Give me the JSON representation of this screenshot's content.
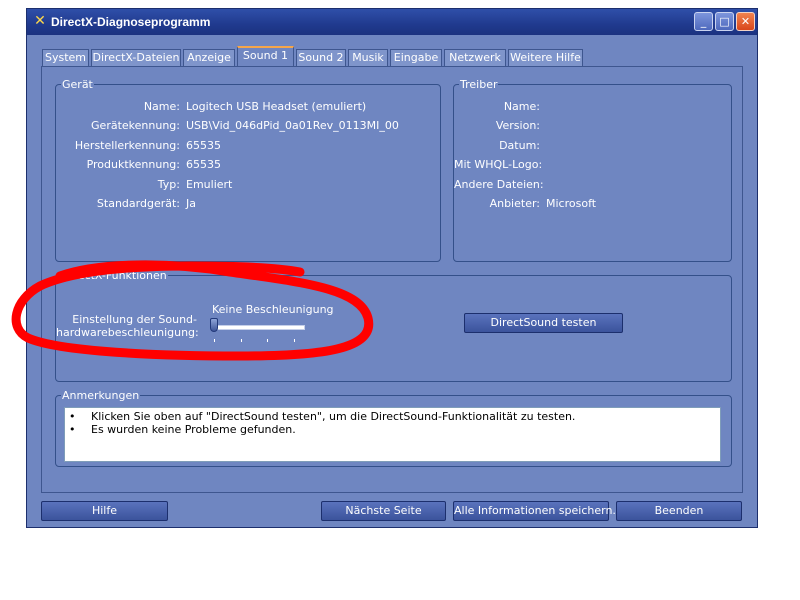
{
  "window": {
    "title": "DirectX-Diagnoseprogramm",
    "icon": "directx-x-icon"
  },
  "title_buttons": {
    "minimize": "_",
    "maximize": "□",
    "close": "✕"
  },
  "tabs": [
    {
      "label": "System"
    },
    {
      "label": "DirectX-Dateien"
    },
    {
      "label": "Anzeige"
    },
    {
      "label": "Sound 1",
      "active": true
    },
    {
      "label": "Sound 2"
    },
    {
      "label": "Musik"
    },
    {
      "label": "Eingabe"
    },
    {
      "label": "Netzwerk"
    },
    {
      "label": "Weitere Hilfe"
    }
  ],
  "device": {
    "legend": "Gerät",
    "rows": [
      {
        "label": "Name:",
        "value": "Logitech USB Headset (emuliert)"
      },
      {
        "label": "Gerätekennung:",
        "value": "USB\\Vid_046dPid_0a01Rev_0113MI_00"
      },
      {
        "label": "Herstellerkennung:",
        "value": "65535"
      },
      {
        "label": "Produktkennung:",
        "value": "65535"
      },
      {
        "label": "Typ:",
        "value": "Emuliert"
      },
      {
        "label": "Standardgerät:",
        "value": "Ja"
      }
    ]
  },
  "driver": {
    "legend": "Treiber",
    "rows": [
      {
        "label": "Name:",
        "value": ""
      },
      {
        "label": "Version:",
        "value": ""
      },
      {
        "label": "Datum:",
        "value": ""
      },
      {
        "label": "Mit WHQL-Logo:",
        "value": ""
      },
      {
        "label": "Andere Dateien:",
        "value": ""
      },
      {
        "label": "Anbieter:",
        "value": "Microsoft"
      }
    ]
  },
  "directx": {
    "legend": "DirectX-Funktionen",
    "accel_label_line1": "Einstellung der Sound-",
    "accel_label_line2": "hardwarebeschleunigung:",
    "slider_value_text": "Keine Beschleunigung",
    "slider_level": 0,
    "test_button": "DirectSound testen"
  },
  "notes": {
    "legend": "Anmerkungen",
    "bullet": "•",
    "items": [
      "Klicken Sie oben auf \"DirectSound testen\", um die DirectSound-Funktionalität zu testen.",
      "Es wurden keine Probleme gefunden."
    ]
  },
  "footer": {
    "help": "Hilfe",
    "next": "Nächste Seite",
    "save": "Alle Informationen speichern...",
    "exit": "Beenden"
  },
  "colors": {
    "window_bg": "#6f86c1",
    "title_bg": "#203a8e",
    "annotation_red": "#ff0000"
  }
}
